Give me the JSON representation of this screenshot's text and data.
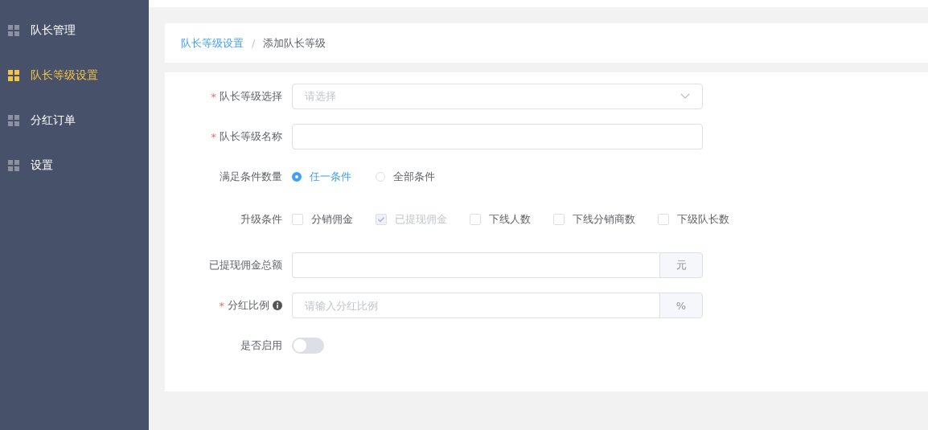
{
  "sidebar": {
    "items": [
      {
        "label": "队长管理",
        "selected": false
      },
      {
        "label": "队长等级设置",
        "selected": true
      },
      {
        "label": "分红订单",
        "selected": false
      },
      {
        "label": "设置",
        "selected": false
      }
    ]
  },
  "breadcrumb": [
    {
      "label": "队长等级设置",
      "kind": "link"
    },
    {
      "label": "添加队长等级",
      "kind": "current"
    }
  ],
  "breadcrumb_separator": "/",
  "form": {
    "rows": [
      {
        "kind": "select",
        "label": "队长等级选择",
        "required_mark": "*",
        "placeholder": "请选择"
      },
      {
        "kind": "input",
        "label": "队长等级名称",
        "required_mark": "*"
      },
      {
        "kind": "radio",
        "label": "满足条件数量",
        "options": [
          {
            "label": "任一条件",
            "selected": true
          },
          {
            "label": "全部条件",
            "selected": false
          }
        ]
      },
      {
        "kind": "checkbox",
        "label": "升级条件",
        "options": [
          {
            "label": "分销佣金",
            "checked": false,
            "disabled": false
          },
          {
            "label": "已提现佣金",
            "checked": true,
            "disabled": true
          },
          {
            "label": "下线人数",
            "checked": false,
            "disabled": false
          },
          {
            "label": "下线分销商数",
            "checked": false,
            "disabled": false
          },
          {
            "label": "下级队长数",
            "checked": false,
            "disabled": false
          }
        ]
      },
      {
        "kind": "append",
        "label": "已提现佣金总额",
        "append": "元"
      },
      {
        "kind": "append",
        "label": "分红比例",
        "required_mark": "*",
        "info": true,
        "placeholder": "请输入分红比例",
        "append": "%"
      },
      {
        "kind": "switch",
        "label": "是否启用",
        "on": false
      }
    ]
  }
}
